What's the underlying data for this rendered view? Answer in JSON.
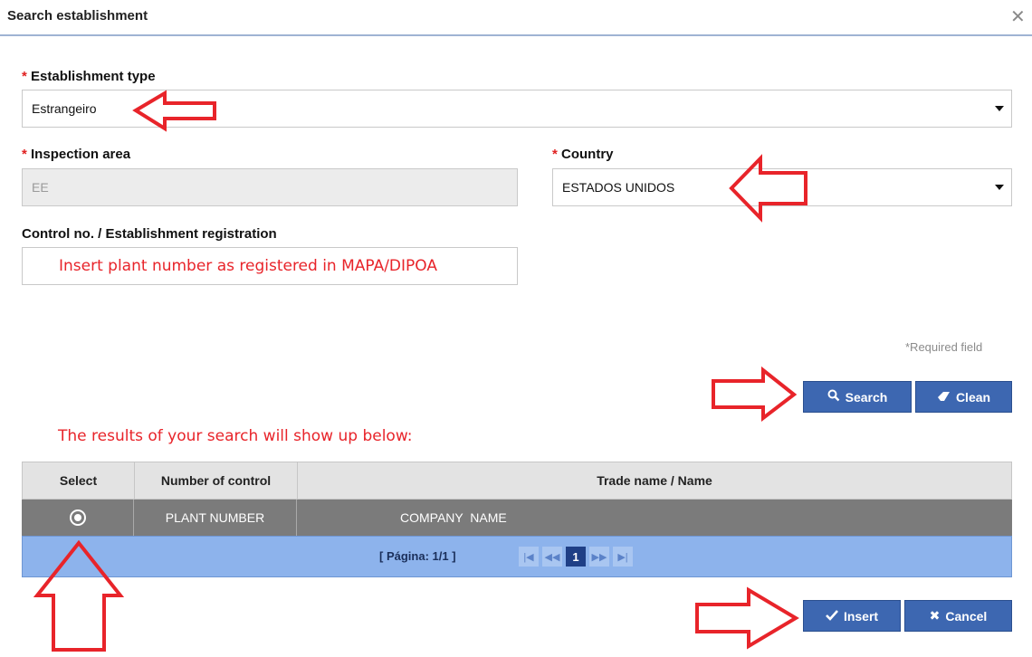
{
  "dialog": {
    "title": "Search establishment",
    "close_icon": "close-icon"
  },
  "form": {
    "required_mark": "*",
    "establishment_type": {
      "label": "Establishment type",
      "value": "Estrangeiro"
    },
    "inspection_area": {
      "label": "Inspection area",
      "value": "EE"
    },
    "country": {
      "label": "Country",
      "value": "ESTADOS UNIDOS"
    },
    "control_no": {
      "label": "Control no. / Establishment registration",
      "hint": "Insert plant number as registered in MAPA/DIPOA"
    },
    "required_note": "*Required field"
  },
  "actions": {
    "search_label": "Search",
    "clean_label": "Clean",
    "insert_label": "Insert",
    "cancel_label": "Cancel"
  },
  "results": {
    "note": "The results of your search will show up below:",
    "columns": [
      "Select",
      "Number of control",
      "Trade name / Name"
    ],
    "rows": [
      {
        "number": "PLANT NUMBER",
        "name": "COMPANY  NAME"
      }
    ],
    "pager": {
      "info": "[ Página: 1/1 ]",
      "current_page": "1"
    }
  },
  "colors": {
    "accent": "#3d67b1",
    "annotation": "#e8242a",
    "row_selected": "#7b7b7b",
    "pager_bg": "#8db3ec"
  }
}
